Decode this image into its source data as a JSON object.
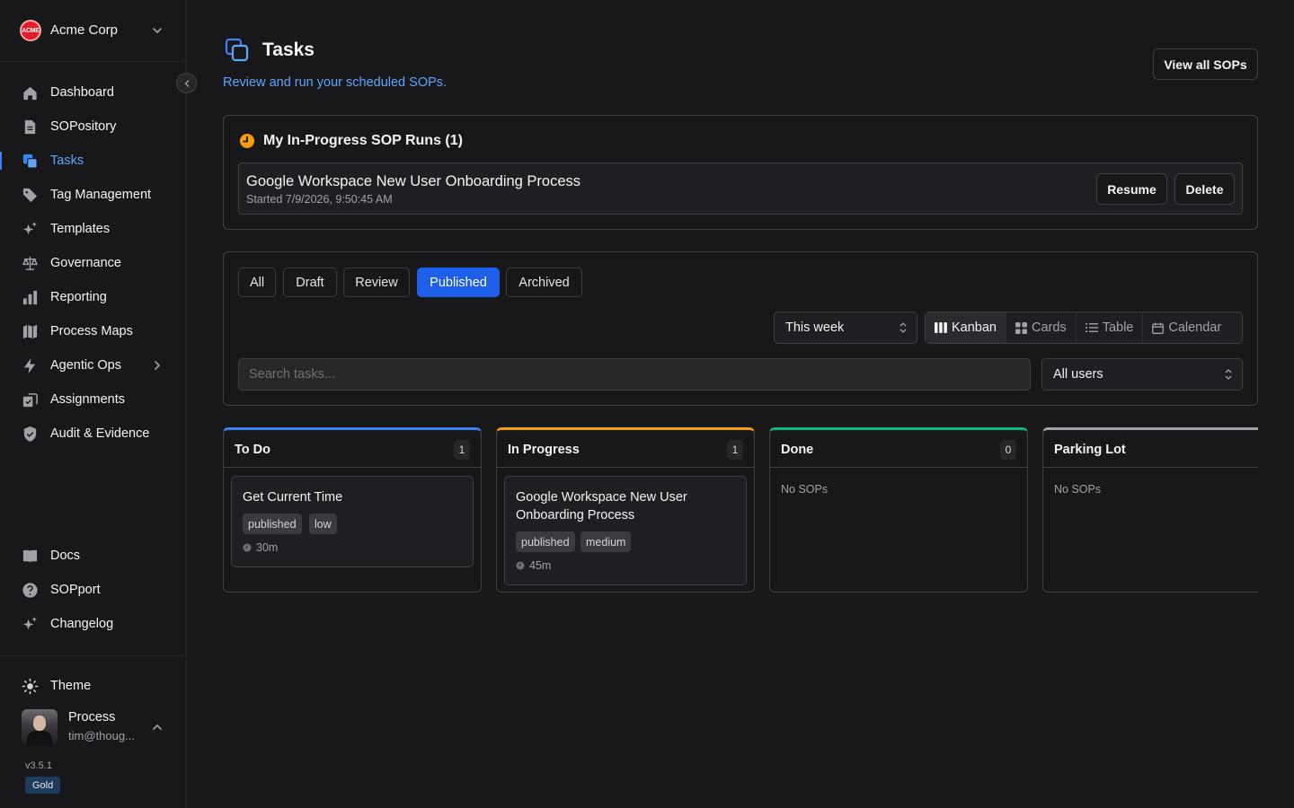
{
  "org": {
    "name": "Acme Corp",
    "logo_text": "ACME"
  },
  "sidebar": {
    "items": [
      {
        "label": "Dashboard",
        "icon": "home-icon"
      },
      {
        "label": "SOPository",
        "icon": "document-icon"
      },
      {
        "label": "Tasks",
        "icon": "copy-icon",
        "active": true
      },
      {
        "label": "Tag Management",
        "icon": "tag-icon"
      },
      {
        "label": "Templates",
        "icon": "sparkles-icon"
      },
      {
        "label": "Governance",
        "icon": "scale-icon"
      },
      {
        "label": "Reporting",
        "icon": "bar-chart-icon"
      },
      {
        "label": "Process Maps",
        "icon": "map-icon"
      },
      {
        "label": "Agentic Ops",
        "icon": "lightning-icon"
      },
      {
        "label": "Assignments",
        "icon": "assignment-icon"
      },
      {
        "label": "Audit & Evidence",
        "icon": "shield-check-icon"
      }
    ],
    "bottom_items": [
      {
        "label": "Docs",
        "icon": "book-icon"
      },
      {
        "label": "SOPport",
        "icon": "help-circle-icon"
      },
      {
        "label": "Changelog",
        "icon": "sparkles-icon"
      }
    ],
    "theme_label": "Theme",
    "user": {
      "name": "Process",
      "email": "tim@thoug..."
    },
    "version": "v3.5.1",
    "plan": "Gold"
  },
  "header": {
    "title": "Tasks",
    "subtitle": "Review and run your scheduled SOPs.",
    "view_all_label": "View all SOPs"
  },
  "in_progress": {
    "title": "My In-Progress SOP Runs (1)",
    "runs": [
      {
        "title": "Google Workspace New User Onboarding Process",
        "started": "Started 7/9/2026, 9:50:45 AM",
        "resume_label": "Resume",
        "delete_label": "Delete"
      }
    ]
  },
  "filters": {
    "status_tabs": [
      "All",
      "Draft",
      "Review",
      "Published",
      "Archived"
    ],
    "active_status": "Published",
    "period": "This week",
    "views": [
      "Kanban",
      "Cards",
      "Table",
      "Calendar"
    ],
    "active_view": "Kanban",
    "search_placeholder": "Search tasks...",
    "users": "All users"
  },
  "board": {
    "columns": [
      {
        "title": "To Do",
        "count": "1",
        "accent": "#3b82f6",
        "cards": [
          {
            "title": "Get Current Time",
            "status": "published",
            "priority": "low",
            "duration": "30m"
          }
        ]
      },
      {
        "title": "In Progress",
        "count": "1",
        "accent": "#f59e0b",
        "cards": [
          {
            "title": "Google Workspace New User Onboarding Process",
            "status": "published",
            "priority": "medium",
            "duration": "45m"
          }
        ]
      },
      {
        "title": "Done",
        "count": "0",
        "accent": "#10b981",
        "empty_text": "No SOPs"
      },
      {
        "title": "Parking Lot",
        "accent": "#a1a1aa",
        "empty_text": "No SOPs"
      }
    ]
  },
  "colors": {
    "background": "#18181b",
    "accent_blue": "#1d5fe8",
    "link_blue": "#60a5fa",
    "warning_orange": "#f59e0b"
  }
}
